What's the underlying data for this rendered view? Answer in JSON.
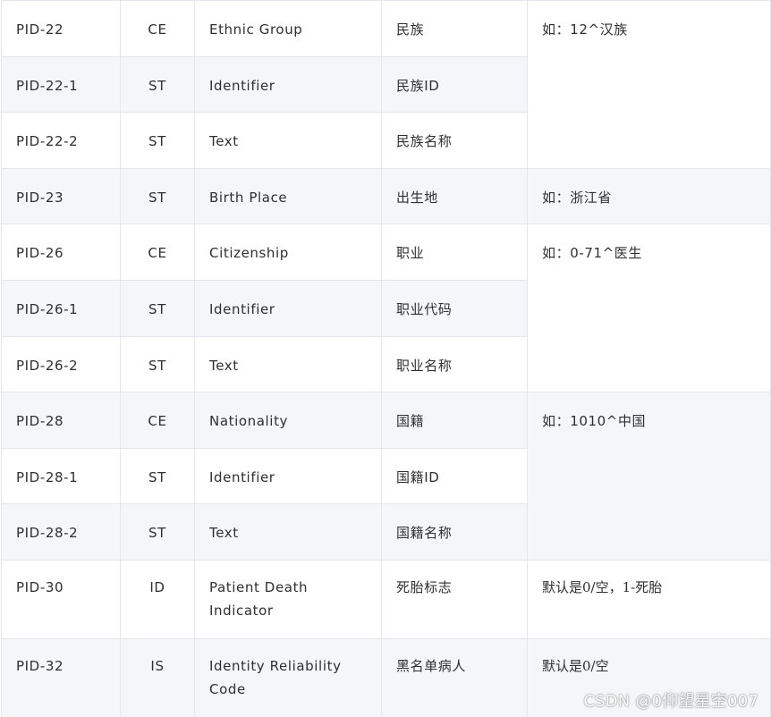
{
  "rows": [
    {
      "field": "PID-22",
      "type": "CE",
      "name": "Ethnic Group",
      "cn": "民族"
    },
    {
      "field": "PID-22-1",
      "type": "ST",
      "name": "Identifier",
      "cn": "民族ID"
    },
    {
      "field": "PID-22-2",
      "type": "ST",
      "name": "Text",
      "cn": "民族名称"
    },
    {
      "field": "PID-23",
      "type": "ST",
      "name": "Birth Place",
      "cn": "出生地"
    },
    {
      "field": "PID-26",
      "type": "CE",
      "name": "Citizenship",
      "cn": "职业"
    },
    {
      "field": "PID-26-1",
      "type": "ST",
      "name": "Identifier",
      "cn": "职业代码"
    },
    {
      "field": "PID-26-2",
      "type": "ST",
      "name": "Text",
      "cn": "职业名称"
    },
    {
      "field": "PID-28",
      "type": "CE",
      "name": "Nationality",
      "cn": "国籍"
    },
    {
      "field": "PID-28-1",
      "type": "ST",
      "name": "Identifier",
      "cn": "国籍ID"
    },
    {
      "field": "PID-28-2",
      "type": "ST",
      "name": "Text",
      "cn": "国籍名称"
    },
    {
      "field": "PID-30",
      "type": "ID",
      "name": "Patient Death Indicator",
      "cn": "死胎标志"
    },
    {
      "field": "PID-32",
      "type": "IS",
      "name": "Identity Reliability Code",
      "cn": "黑名单病人"
    }
  ],
  "notes": {
    "pid22": "如：12^汉族",
    "pid23": "如：浙江省",
    "pid26": "如：0-71^医生",
    "pid28": "如：1010^中国",
    "pid30": "默认是0/空，1-死胎",
    "pid32": "默认是0/空"
  },
  "watermark": "CSDN @0仰望星空007"
}
